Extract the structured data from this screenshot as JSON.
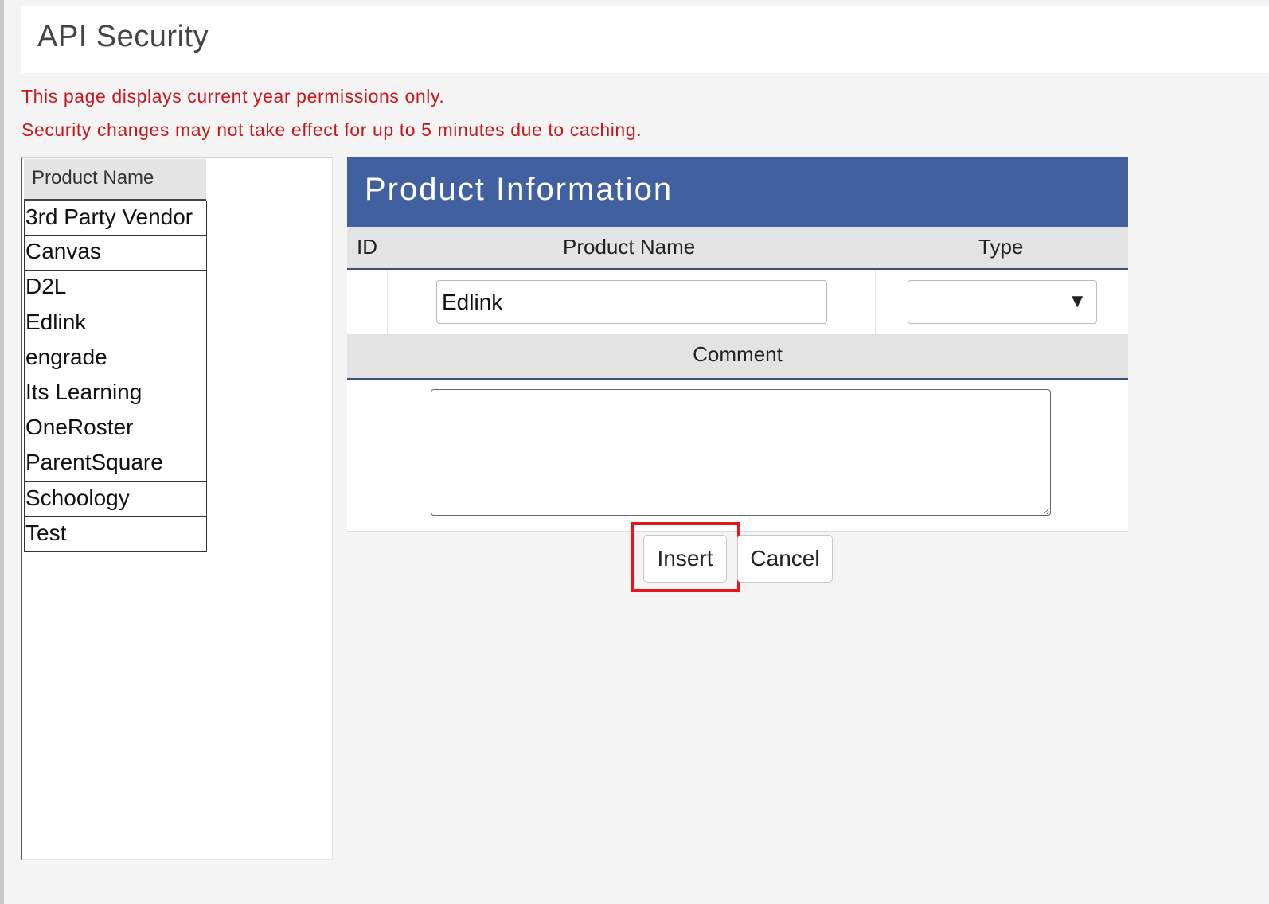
{
  "header": {
    "title": "API Security"
  },
  "notices": [
    "This page displays current year permissions only.",
    "Security changes may not take effect for up to 5 minutes due to caching."
  ],
  "product_list": {
    "header": "Product Name",
    "items": [
      "3rd Party Vendor",
      "Canvas",
      "D2L",
      "Edlink",
      "engrade",
      "Its Learning",
      "OneRoster",
      "ParentSquare",
      "Schoology",
      "Test"
    ]
  },
  "product_info": {
    "title": "Product Information",
    "columns": {
      "id": "ID",
      "name": "Product Name",
      "type": "Type"
    },
    "fields": {
      "id": "",
      "name": "Edlink",
      "type": ""
    },
    "comment_header": "Comment",
    "comment_value": ""
  },
  "buttons": {
    "insert": "Insert",
    "cancel": "Cancel"
  },
  "icons": {
    "dropdown": "chevron-down-icon"
  },
  "colors": {
    "title_bar": "#41609f",
    "notice_text": "#c8161d",
    "highlight": "#e8141b"
  }
}
